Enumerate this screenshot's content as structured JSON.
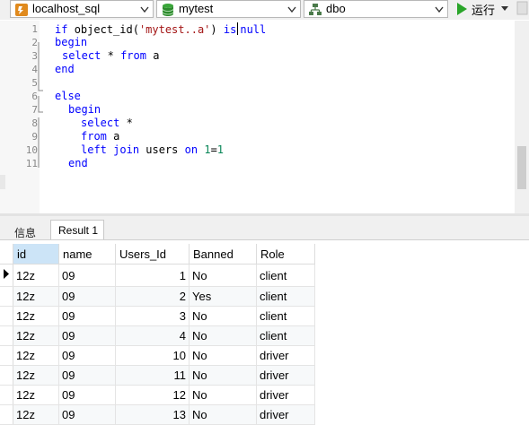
{
  "toolbar": {
    "connection": "localhost_sql",
    "database": "mytest",
    "schema": "dbo",
    "run_label": "运行"
  },
  "editor": {
    "line_numbers": [
      "1",
      "2",
      "3",
      "4",
      "5",
      "6",
      "7",
      "8",
      "9",
      "10",
      "11"
    ],
    "lines": [
      "if object_id('mytest..a') is null",
      "begin",
      "select * from a",
      "end",
      "",
      "else",
      "begin",
      "select *",
      "from a",
      "left join users on 1=1",
      "end"
    ]
  },
  "result_tabs": {
    "info": "信息",
    "result": "Result 1"
  },
  "grid": {
    "columns": [
      "id",
      "name",
      "Users_Id",
      "Banned",
      "Role"
    ],
    "rows": [
      [
        "12z",
        "09",
        "1",
        "No",
        "client"
      ],
      [
        "12z",
        "09",
        "2",
        "Yes",
        "client"
      ],
      [
        "12z",
        "09",
        "3",
        "No",
        "client"
      ],
      [
        "12z",
        "09",
        "4",
        "No",
        "client"
      ],
      [
        "12z",
        "09",
        "10",
        "No",
        "driver"
      ],
      [
        "12z",
        "09",
        "11",
        "No",
        "driver"
      ],
      [
        "12z",
        "09",
        "12",
        "No",
        "driver"
      ],
      [
        "12z",
        "09",
        "13",
        "No",
        "driver"
      ]
    ]
  }
}
